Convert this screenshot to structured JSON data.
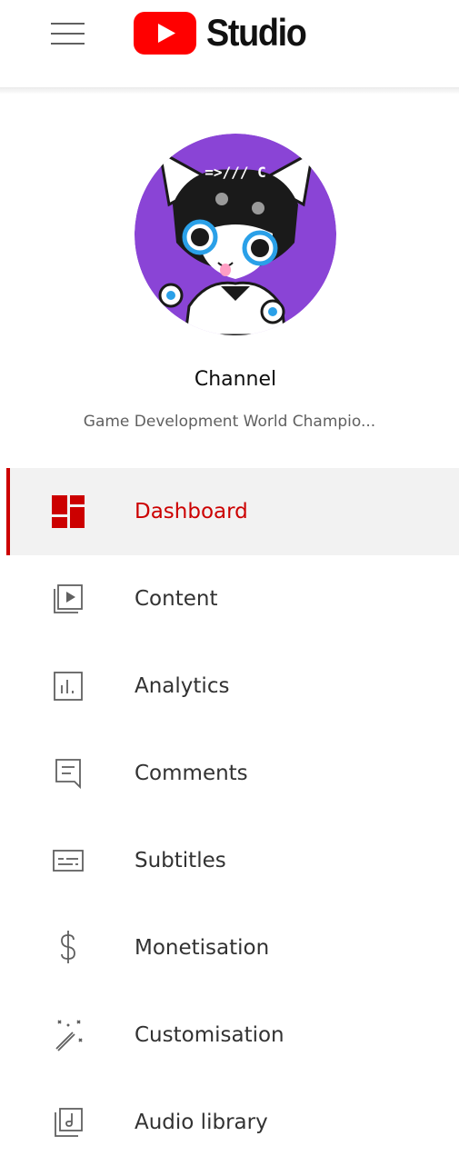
{
  "header": {
    "menu_icon": "hamburger-menu-icon",
    "logo_icon": "youtube-play-logo-icon",
    "logo_text": "Studio",
    "brand_color": "#ff0000"
  },
  "channel": {
    "avatar_icon": "channel-avatar-image",
    "title": "Channel",
    "name": "Game Development World Champio..."
  },
  "nav": {
    "active_color": "#cc0000",
    "items": [
      {
        "label": "Dashboard",
        "icon": "dashboard-icon",
        "active": true
      },
      {
        "label": "Content",
        "icon": "content-video-icon",
        "active": false
      },
      {
        "label": "Analytics",
        "icon": "analytics-icon",
        "active": false
      },
      {
        "label": "Comments",
        "icon": "comments-icon",
        "active": false
      },
      {
        "label": "Subtitles",
        "icon": "subtitles-icon",
        "active": false
      },
      {
        "label": "Monetisation",
        "icon": "dollar-icon",
        "active": false
      },
      {
        "label": "Customisation",
        "icon": "magic-wand-icon",
        "active": false
      },
      {
        "label": "Audio library",
        "icon": "audio-library-icon",
        "active": false
      }
    ]
  }
}
